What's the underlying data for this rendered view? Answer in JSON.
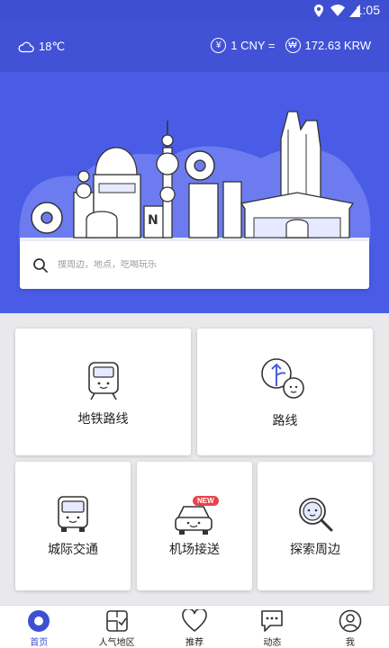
{
  "statusbar": {
    "time": "1:05"
  },
  "info": {
    "temperature": "18℃",
    "rate_left": "1 CNY =",
    "rate_right": "172.63 KRW",
    "yen_symbol": "¥",
    "won_symbol": "₩"
  },
  "search": {
    "placeholder": "搜周边，地点，吃喝玩乐"
  },
  "cards": {
    "subway": "地铁路线",
    "route": "路线",
    "intercity": "城际交通",
    "airport": "机场接送",
    "airport_badge": "NEW",
    "explore": "探索周边"
  },
  "tabs": [
    {
      "label": "首页"
    },
    {
      "label": "人气地区"
    },
    {
      "label": "推荐"
    },
    {
      "label": "动态"
    },
    {
      "label": "我"
    }
  ],
  "colors": {
    "primary": "#4a5ce6",
    "header": "#4152d6",
    "badge": "#e8424c"
  }
}
